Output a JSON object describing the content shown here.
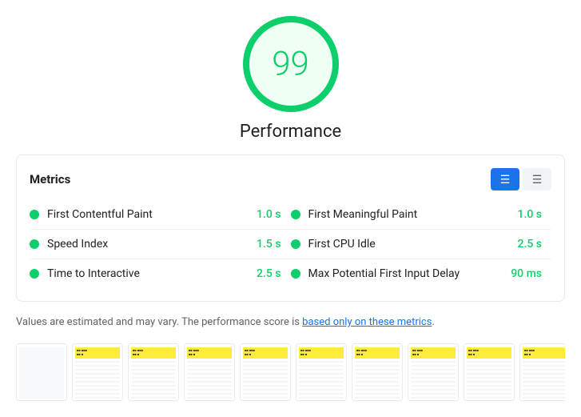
{
  "score": {
    "value": "99",
    "label": "Performance"
  },
  "metrics": {
    "title": "Metrics",
    "items_left": [
      {
        "name": "First Contentful Paint",
        "value": "1.0 s",
        "color": "#0cce6b"
      },
      {
        "name": "Speed Index",
        "value": "1.5 s",
        "color": "#0cce6b"
      },
      {
        "name": "Time to Interactive",
        "value": "2.5 s",
        "color": "#0cce6b"
      }
    ],
    "items_right": [
      {
        "name": "First Meaningful Paint",
        "value": "1.0 s",
        "color": "#0cce6b"
      },
      {
        "name": "First CPU Idle",
        "value": "2.5 s",
        "color": "#0cce6b"
      },
      {
        "name": "Max Potential First Input Delay",
        "value": "90 ms",
        "color": "#0cce6b"
      }
    ]
  },
  "toggle": {
    "view1_icon": "≡",
    "view2_icon": "≡"
  },
  "note": {
    "text_before": "Values are estimated and may vary. The performance score is ",
    "link_text": "based only on these metrics",
    "text_after": "."
  },
  "filmstrip": {
    "frames": [
      {
        "blank": true
      },
      {
        "blank": false
      },
      {
        "blank": false
      },
      {
        "blank": false
      },
      {
        "blank": false
      },
      {
        "blank": false
      },
      {
        "blank": false
      },
      {
        "blank": false
      },
      {
        "blank": false
      },
      {
        "blank": false
      }
    ]
  }
}
